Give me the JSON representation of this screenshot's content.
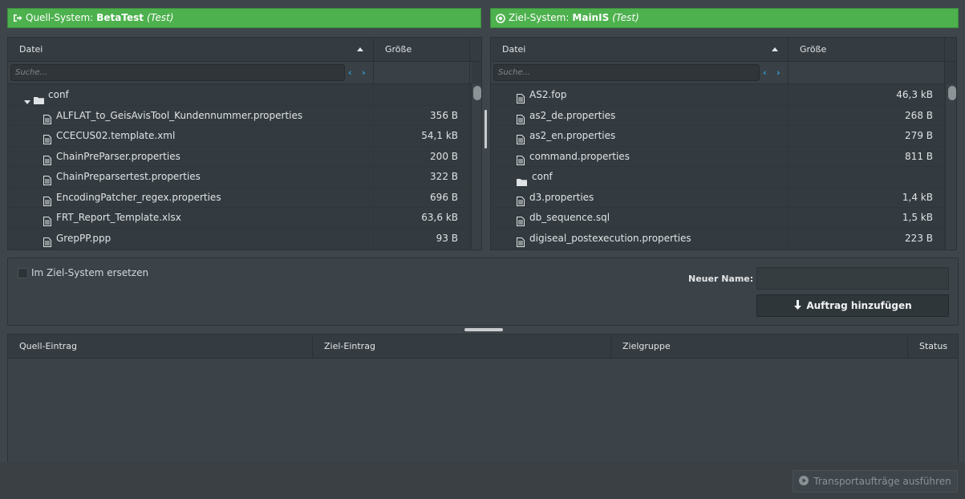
{
  "source_bar": {
    "prefix": "Quell-System: ",
    "system": "BetaTest",
    "env": "(Test)"
  },
  "target_bar": {
    "prefix": "Ziel-System: ",
    "system": "MainIS",
    "env": "(Test)"
  },
  "source_grid": {
    "col_file": "Datei",
    "col_size": "Größe",
    "search_placeholder": "Suche...",
    "rows": [
      {
        "type": "folder",
        "name": "conf",
        "size": ""
      },
      {
        "type": "file",
        "name": "ALFLAT_to_GeisAvisTool_Kundennummer.properties",
        "size": "356 B"
      },
      {
        "type": "file",
        "name": "CCECUS02.template.xml",
        "size": "54,1 kB"
      },
      {
        "type": "file",
        "name": "ChainPreParser.properties",
        "size": "200 B"
      },
      {
        "type": "file",
        "name": "ChainPreparsertest.properties",
        "size": "322 B"
      },
      {
        "type": "file",
        "name": "EncodingPatcher_regex.properties",
        "size": "696 B"
      },
      {
        "type": "file",
        "name": "FRT_Report_Template.xlsx",
        "size": "63,6 kB"
      },
      {
        "type": "file",
        "name": "GrepPP.ppp",
        "size": "93 B"
      }
    ]
  },
  "target_grid": {
    "col_file": "Datei",
    "col_size": "Größe",
    "search_placeholder": "Suche...",
    "rows": [
      {
        "type": "file",
        "name": "AS2.fop",
        "size": "46,3 kB"
      },
      {
        "type": "file",
        "name": "as2_de.properties",
        "size": "268 B"
      },
      {
        "type": "file",
        "name": "as2_en.properties",
        "size": "279 B"
      },
      {
        "type": "file",
        "name": "command.properties",
        "size": "811 B"
      },
      {
        "type": "folder",
        "name": "conf",
        "size": ""
      },
      {
        "type": "file",
        "name": "d3.properties",
        "size": "1,4 kB"
      },
      {
        "type": "file",
        "name": "db_sequence.sql",
        "size": "1,5 kB"
      },
      {
        "type": "file",
        "name": "digiseal_postexecution.properties",
        "size": "223 B"
      }
    ]
  },
  "options": {
    "replace_label": "Im Ziel-System ersetzen",
    "replace_checked": false,
    "new_name_label": "Neuer Name:",
    "new_name_value": "",
    "add_button": "Auftrag hinzufügen"
  },
  "jobs_table": {
    "columns": [
      "Quell-Eintrag",
      "Ziel-Eintrag",
      "Zielgruppe",
      "Status"
    ],
    "rows": []
  },
  "run_button": "Transportaufträge ausführen",
  "colors": {
    "accent_green": "#4db14e",
    "link_blue": "#2ba3e0",
    "background": "#3f464b"
  },
  "icons": [
    "sign-out-icon",
    "target-circle-icon",
    "file-icon",
    "folder-icon",
    "caret-down-icon",
    "arrow-down-icon",
    "play-circle-icon",
    "chevron-left-icon",
    "chevron-right-icon",
    "sort-asc-icon"
  ]
}
